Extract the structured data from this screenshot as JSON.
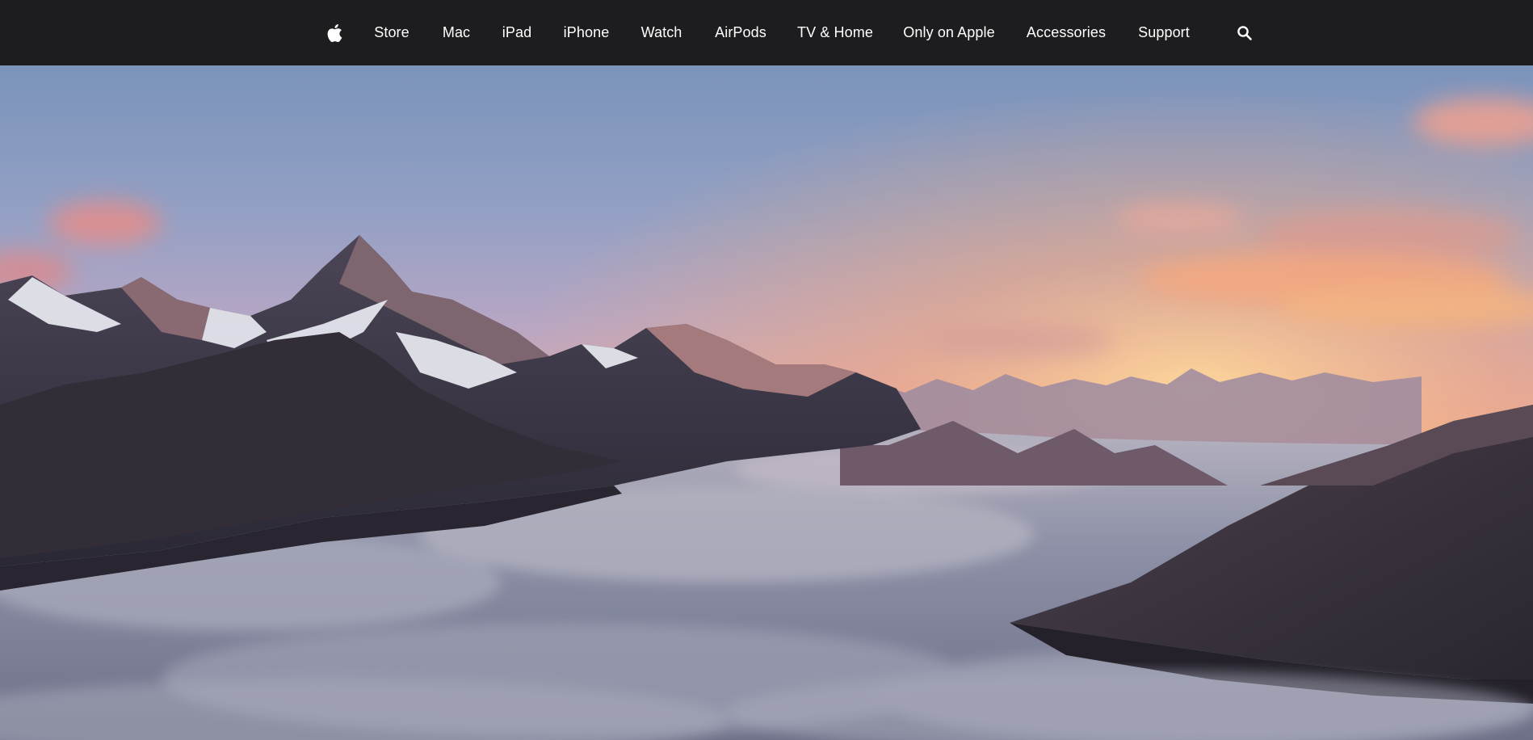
{
  "nav": {
    "apple_logo": "apple-logo-icon",
    "items": [
      {
        "label": "Store"
      },
      {
        "label": "Mac"
      },
      {
        "label": "iPad"
      },
      {
        "label": "iPhone"
      },
      {
        "label": "Watch"
      },
      {
        "label": "AirPods"
      },
      {
        "label": "TV & Home"
      },
      {
        "label": "Only on Apple"
      },
      {
        "label": "Accessories"
      },
      {
        "label": "Support"
      }
    ],
    "search_icon": "search-icon",
    "background_color": "#1d1d1f",
    "text_color": "#ffffff"
  },
  "hero": {
    "image": "alpine-peaks-sunset-above-clouds",
    "colors": {
      "sky_top": "#7f97bd",
      "sky_mid": "#b7a3c0",
      "horizon_glow": "#f6b57a",
      "clouds": "#8f93a8",
      "mountains": "#3a3442"
    }
  }
}
